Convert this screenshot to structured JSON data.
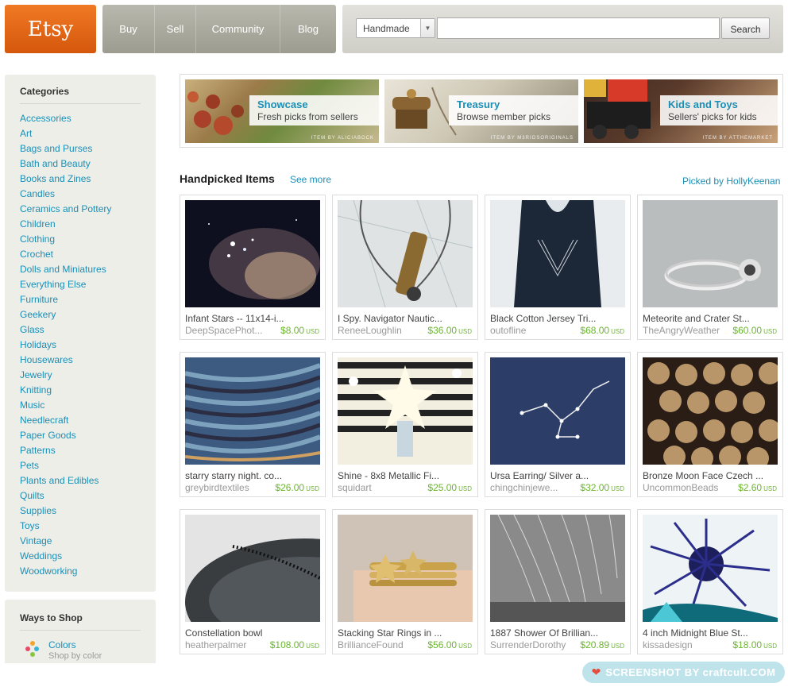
{
  "header": {
    "logo": "Etsy",
    "nav": [
      "Buy",
      "Sell",
      "Community",
      "Blog"
    ],
    "search": {
      "scope": "Handmade",
      "query": "",
      "button": "Search"
    }
  },
  "sidebar": {
    "categories_title": "Categories",
    "categories": [
      "Accessories",
      "Art",
      "Bags and Purses",
      "Bath and Beauty",
      "Books and Zines",
      "Candles",
      "Ceramics and Pottery",
      "Children",
      "Clothing",
      "Crochet",
      "Dolls and Miniatures",
      "Everything Else",
      "Furniture",
      "Geekery",
      "Glass",
      "Holidays",
      "Housewares",
      "Jewelry",
      "Knitting",
      "Music",
      "Needlecraft",
      "Paper Goods",
      "Patterns",
      "Pets",
      "Plants and Edibles",
      "Quilts",
      "Supplies",
      "Toys",
      "Vintage",
      "Weddings",
      "Woodworking"
    ],
    "ways_title": "Ways to Shop",
    "ways": [
      {
        "label": "Colors",
        "sub": "Shop by color"
      }
    ]
  },
  "banners": [
    {
      "title": "Showcase",
      "subtitle": "Fresh picks from sellers",
      "credit": "ITEM BY ALICIABOCK"
    },
    {
      "title": "Treasury",
      "subtitle": "Browse member picks",
      "credit": "ITEM BY M3RIOSORIGINALS"
    },
    {
      "title": "Kids and Toys",
      "subtitle": "Sellers' picks for kids",
      "credit": "ITEM BY ATTHEMARKET"
    }
  ],
  "handpicked": {
    "title": "Handpicked Items",
    "see_more": "See more",
    "picked_by": "Picked by HollyKeenan",
    "currency": "USD",
    "items": [
      {
        "title": "Infant Stars -- 11x14-i...",
        "seller": "DeepSpacePhot...",
        "price": "$8.00"
      },
      {
        "title": "I Spy. Navigator Nautic...",
        "seller": "ReneeLoughlin",
        "price": "$36.00"
      },
      {
        "title": "Black Cotton Jersey Tri...",
        "seller": "outofline",
        "price": "$68.00"
      },
      {
        "title": "Meteorite and Crater St...",
        "seller": "TheAngryWeather",
        "price": "$60.00"
      },
      {
        "title": "starry starry night. co...",
        "seller": "greybirdtextiles",
        "price": "$26.00"
      },
      {
        "title": "Shine - 8x8 Metallic Fi...",
        "seller": "squidart",
        "price": "$25.00"
      },
      {
        "title": "Ursa Earring/ Silver a...",
        "seller": "chingchinjewe...",
        "price": "$32.00"
      },
      {
        "title": "Bronze Moon Face Czech ...",
        "seller": "UncommonBeads",
        "price": "$2.60"
      },
      {
        "title": "Constellation bowl",
        "seller": "heatherpalmer",
        "price": "$108.00"
      },
      {
        "title": "Stacking Star Rings in ...",
        "seller": "BrillianceFound",
        "price": "$56.00"
      },
      {
        "title": "1887 Shower Of Brillian...",
        "seller": "SurrenderDorothy",
        "price": "$20.89"
      },
      {
        "title": "4 inch Midnight Blue St...",
        "seller": "kissadesign",
        "price": "$18.00"
      }
    ]
  },
  "watermark": "SCREENSHOT BY craftcult.COM",
  "colors": {
    "brand": "#e8661a",
    "link": "#1a8fb6",
    "price": "#6bb52e"
  }
}
